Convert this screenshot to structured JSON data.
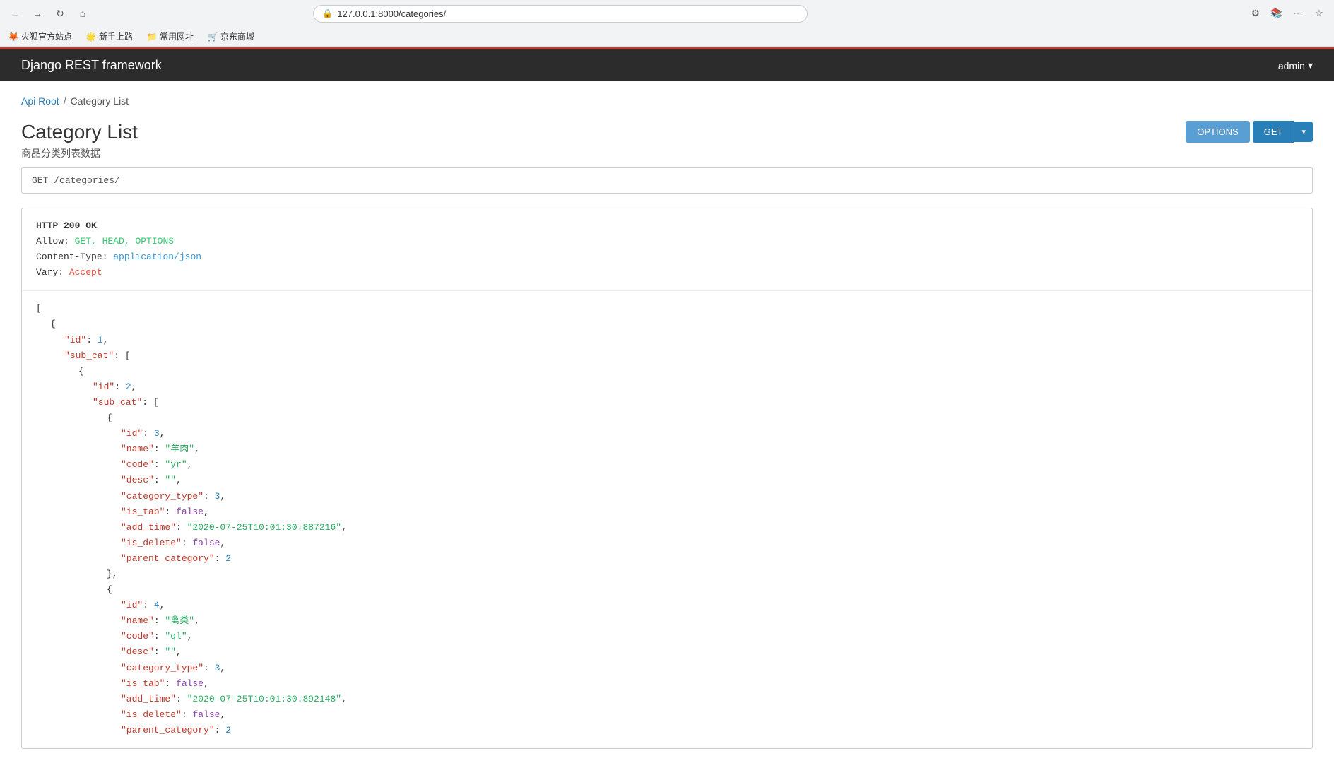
{
  "browser": {
    "url": "127.0.0.1:8000/categories/",
    "bookmarks": [
      {
        "label": "火狐官方站点",
        "icon": "🦊"
      },
      {
        "label": "新手上路",
        "icon": "🌟"
      },
      {
        "label": "常用网址",
        "icon": "📁"
      },
      {
        "label": "京东商城",
        "icon": "🛒"
      }
    ]
  },
  "header": {
    "title": "Django REST framework",
    "user": "admin",
    "user_dropdown": "▾"
  },
  "breadcrumb": {
    "api_root": "Api Root",
    "separator": "/",
    "current": "Category List"
  },
  "page": {
    "title": "Category List",
    "subtitle": "商品分类列表数据"
  },
  "buttons": {
    "options": "OPTIONS",
    "get": "GET",
    "get_arrow": "▾"
  },
  "request": {
    "method": "GET",
    "path": "/categories/"
  },
  "response": {
    "status": "HTTP 200 OK",
    "allow_label": "Allow:",
    "allow_value": "GET, HEAD, OPTIONS",
    "content_type_label": "Content-Type:",
    "content_type_value": "application/json",
    "vary_label": "Vary:",
    "vary_value": "Accept"
  },
  "json_body": {
    "lines": [
      {
        "indent": 0,
        "text": "["
      },
      {
        "indent": 1,
        "text": "{"
      },
      {
        "indent": 2,
        "key": "\"id\"",
        "value": "1",
        "type": "number",
        "comma": ","
      },
      {
        "indent": 2,
        "key": "\"sub_cat\"",
        "value": "[",
        "type": "bracket"
      },
      {
        "indent": 3,
        "text": "{"
      },
      {
        "indent": 4,
        "key": "\"id\"",
        "value": "2",
        "type": "number",
        "comma": ","
      },
      {
        "indent": 4,
        "key": "\"sub_cat\"",
        "value": "[",
        "type": "bracket"
      },
      {
        "indent": 5,
        "text": "{"
      },
      {
        "indent": 6,
        "key": "\"id\"",
        "value": "3",
        "type": "number",
        "comma": ","
      },
      {
        "indent": 6,
        "key": "\"name\"",
        "value": "\"羊肉\"",
        "type": "string",
        "comma": ","
      },
      {
        "indent": 6,
        "key": "\"code\"",
        "value": "\"yr\"",
        "type": "string",
        "comma": ","
      },
      {
        "indent": 6,
        "key": "\"desc\"",
        "value": "\"\"",
        "type": "string",
        "comma": ","
      },
      {
        "indent": 6,
        "key": "\"category_type\"",
        "value": "3",
        "type": "number",
        "comma": ","
      },
      {
        "indent": 6,
        "key": "\"is_tab\"",
        "value": "false",
        "type": "bool",
        "comma": ","
      },
      {
        "indent": 6,
        "key": "\"add_time\"",
        "value": "\"2020-07-25T10:01:30.887216\"",
        "type": "string",
        "comma": ","
      },
      {
        "indent": 6,
        "key": "\"is_delete\"",
        "value": "false",
        "type": "bool",
        "comma": ","
      },
      {
        "indent": 6,
        "key": "\"parent_category\"",
        "value": "2",
        "type": "number"
      },
      {
        "indent": 5,
        "text": "},"
      },
      {
        "indent": 5,
        "text": "{"
      },
      {
        "indent": 6,
        "key": "\"id\"",
        "value": "4",
        "type": "number",
        "comma": ","
      },
      {
        "indent": 6,
        "key": "\"name\"",
        "value": "\"禽类\"",
        "type": "string",
        "comma": ","
      },
      {
        "indent": 6,
        "key": "\"code\"",
        "value": "\"ql\"",
        "type": "string",
        "comma": ","
      },
      {
        "indent": 6,
        "key": "\"desc\"",
        "value": "\"\"",
        "type": "string",
        "comma": ","
      },
      {
        "indent": 6,
        "key": "\"category_type\"",
        "value": "3",
        "type": "number",
        "comma": ","
      },
      {
        "indent": 6,
        "key": "\"is_tab\"",
        "value": "false",
        "type": "bool",
        "comma": ","
      },
      {
        "indent": 6,
        "key": "\"add_time\"",
        "value": "\"2020-07-25T10:01:30.892148\"",
        "type": "string",
        "comma": ","
      },
      {
        "indent": 6,
        "key": "\"is_delete\"",
        "value": "false",
        "type": "bool",
        "comma": ","
      },
      {
        "indent": 6,
        "key": "\"parent_category\"",
        "value": "2",
        "type": "number"
      }
    ]
  }
}
